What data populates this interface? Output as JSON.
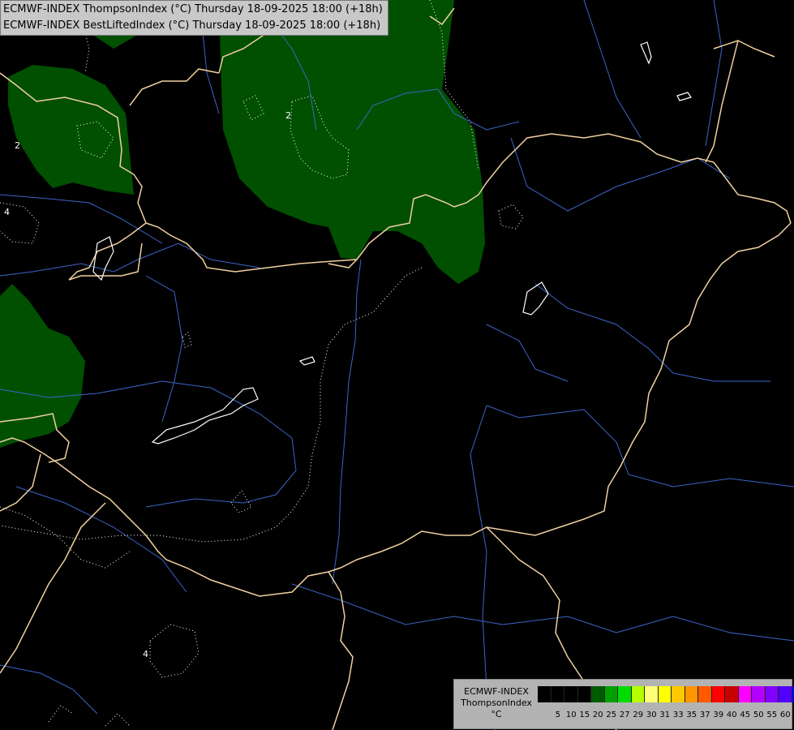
{
  "header": {
    "line1": "ECMWF-INDEX ThompsonIndex (°C) Thursday 18-09-2025 18:00 (+18h)",
    "line2": "ECMWF-INDEX BestLiftedIndex (°C) Thursday 18-09-2025 18:00 (+18h)"
  },
  "legend": {
    "model": "ECMWF-INDEX",
    "parameter": "ThompsonIndex",
    "unit": "°C",
    "ticks": [
      "5",
      "10",
      "15",
      "20",
      "25",
      "27",
      "29",
      "30",
      "31",
      "33",
      "35",
      "37",
      "39",
      "40",
      "45",
      "50",
      "55",
      "60"
    ],
    "colors": [
      "#000000",
      "#000000",
      "#000000",
      "#000000",
      "#005a00",
      "#00a000",
      "#00dc00",
      "#b4ff00",
      "#ffff78",
      "#ffff00",
      "#ffc800",
      "#ff9600",
      "#ff5a00",
      "#ff0000",
      "#c80000",
      "#ff00ff",
      "#b400ff",
      "#8200ff",
      "#5000ff",
      "#0000ff"
    ]
  },
  "map": {
    "colors": {
      "background": "#000000",
      "thompson_fill": "#005000",
      "border": "#f0d0a0",
      "river": "#3c64c8",
      "lifted_contour": "#ffffff"
    },
    "contour_labels": [
      "2",
      "2",
      "4",
      "4"
    ]
  }
}
